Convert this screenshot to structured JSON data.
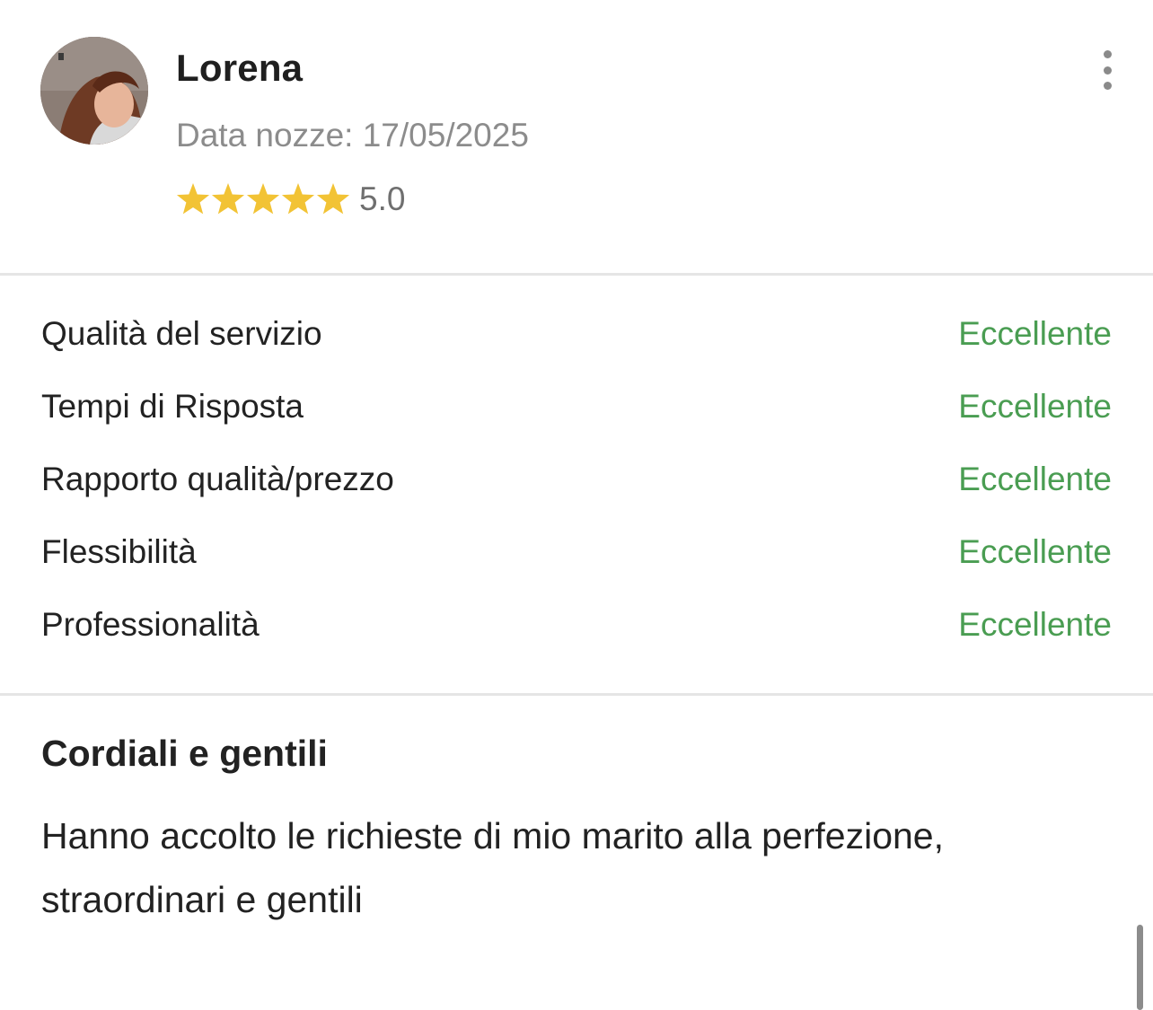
{
  "review": {
    "reviewer_name": "Lorena",
    "wedding_date": "Data nozze: 17/05/2025",
    "rating": {
      "stars": 5,
      "max_stars": 5,
      "value_text": "5.0",
      "star_color": "#f2c335"
    },
    "more_icon": "more-vertical-icon",
    "criteria": [
      {
        "label": "Qualità del servizio",
        "value": "Eccellente"
      },
      {
        "label": "Tempi di Risposta",
        "value": "Eccellente"
      },
      {
        "label": "Rapporto qualità/prezzo",
        "value": "Eccellente"
      },
      {
        "label": "Flessibilità",
        "value": "Eccellente"
      },
      {
        "label": "Professionalità",
        "value": "Eccellente"
      }
    ],
    "title": "Cordiali e gentili",
    "body": "Hanno accolto le richieste di mio marito alla perfezione, straordinari e gentili"
  },
  "colors": {
    "accent_green": "#4a9d52",
    "muted_text": "#8c8c8c",
    "divider": "#e5e5e5"
  }
}
